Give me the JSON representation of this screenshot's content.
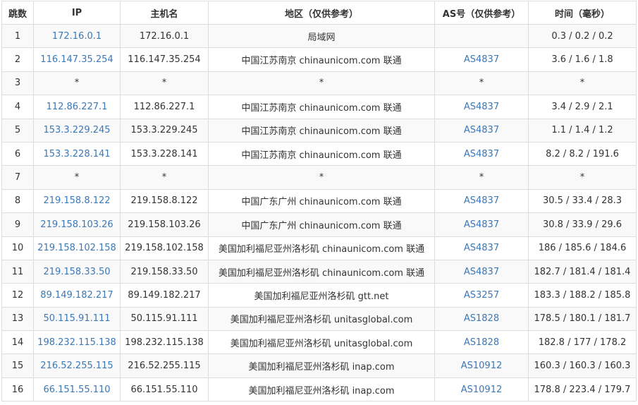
{
  "columns": [
    "跳数",
    "IP",
    "主机名",
    "地区（仅供参考）",
    "AS号（仅供参考）",
    "时间（毫秒）"
  ],
  "rows": [
    {
      "hop": "1",
      "ip": "172.16.0.1",
      "host": "172.16.0.1",
      "region": "局域网",
      "asn": "",
      "time": "0.3 / 0.2 / 0.2"
    },
    {
      "hop": "2",
      "ip": "116.147.35.254",
      "host": "116.147.35.254",
      "region": "中国江苏南京 chinaunicom.com 联通",
      "asn": "AS4837",
      "time": "3.6 / 1.6 / 1.8"
    },
    {
      "hop": "3",
      "ip": "*",
      "host": "*",
      "region": "*",
      "asn": "*",
      "time": "*"
    },
    {
      "hop": "4",
      "ip": "112.86.227.1",
      "host": "112.86.227.1",
      "region": "中国江苏南京 chinaunicom.com 联通",
      "asn": "AS4837",
      "time": "3.4 / 2.9 / 2.1"
    },
    {
      "hop": "5",
      "ip": "153.3.229.245",
      "host": "153.3.229.245",
      "region": "中国江苏南京 chinaunicom.com 联通",
      "asn": "AS4837",
      "time": "1.1 / 1.4 / 1.2"
    },
    {
      "hop": "6",
      "ip": "153.3.228.141",
      "host": "153.3.228.141",
      "region": "中国江苏南京 chinaunicom.com 联通",
      "asn": "AS4837",
      "time": "8.2 / 8.2 / 191.6"
    },
    {
      "hop": "7",
      "ip": "*",
      "host": "*",
      "region": "*",
      "asn": "*",
      "time": "*"
    },
    {
      "hop": "8",
      "ip": "219.158.8.122",
      "host": "219.158.8.122",
      "region": "中国广东广州 chinaunicom.com 联通",
      "asn": "AS4837",
      "time": "30.5 / 33.4 / 28.3"
    },
    {
      "hop": "9",
      "ip": "219.158.103.26",
      "host": "219.158.103.26",
      "region": "中国广东广州 chinaunicom.com 联通",
      "asn": "AS4837",
      "time": "30.8 / 33.9 / 29.6"
    },
    {
      "hop": "10",
      "ip": "219.158.102.158",
      "host": "219.158.102.158",
      "region": "美国加利福尼亚州洛杉矶 chinaunicom.com 联通",
      "asn": "AS4837",
      "time": "186 / 185.6 / 184.6"
    },
    {
      "hop": "11",
      "ip": "219.158.33.50",
      "host": "219.158.33.50",
      "region": "美国加利福尼亚州洛杉矶 chinaunicom.com 联通",
      "asn": "AS4837",
      "time": "182.7 / 181.4 / 181.4"
    },
    {
      "hop": "12",
      "ip": "89.149.182.217",
      "host": "89.149.182.217",
      "region": "美国加利福尼亚州洛杉矶 gtt.net",
      "asn": "AS3257",
      "time": "183.3 / 188.2 / 185.8"
    },
    {
      "hop": "13",
      "ip": "50.115.91.111",
      "host": "50.115.91.111",
      "region": "美国加利福尼亚州洛杉矶 unitasglobal.com",
      "asn": "AS1828",
      "time": "178.5 / 180.1 / 181.7"
    },
    {
      "hop": "14",
      "ip": "198.232.115.138",
      "host": "198.232.115.138",
      "region": "美国加利福尼亚州洛杉矶 unitasglobal.com",
      "asn": "AS1828",
      "time": "182.8 / 177 / 178.2"
    },
    {
      "hop": "15",
      "ip": "216.52.255.115",
      "host": "216.52.255.115",
      "region": "美国加利福尼亚州洛杉矶 inap.com",
      "asn": "AS10912",
      "time": "160.3 / 160.3 / 160.3"
    },
    {
      "hop": "16",
      "ip": "66.151.55.110",
      "host": "66.151.55.110",
      "region": "美国加利福尼亚州洛杉矶 inap.com",
      "asn": "AS10912",
      "time": "178.8 / 223.4 / 179.7"
    }
  ],
  "colors": {
    "link": "#3a78b8",
    "text": "#333333",
    "border": "#dddddd",
    "stripe": "#f9f9f9"
  }
}
